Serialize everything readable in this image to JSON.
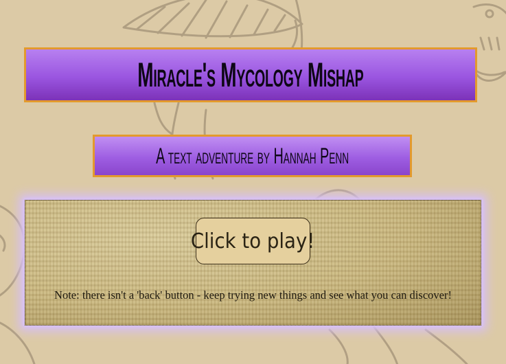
{
  "game": {
    "title": "Miracle's Mycology Mishap",
    "subtitle": "A text adventure by Hannah Penn",
    "play_button_label": "Click to play!",
    "note": "Note: there isn't a 'back' button - keep trying new things and see what you can discover!"
  },
  "colors": {
    "page_background": "#dccaa6",
    "banner_purple": "#9a55e0",
    "banner_border": "#e39a2d",
    "panel_glow": "#d6bef6",
    "button_fill": "#e5d09e"
  },
  "decorations": {
    "background_icons": [
      "mushroom-sketch-icon",
      "mushroom-cap-icon",
      "mushroom-face-icon"
    ]
  }
}
